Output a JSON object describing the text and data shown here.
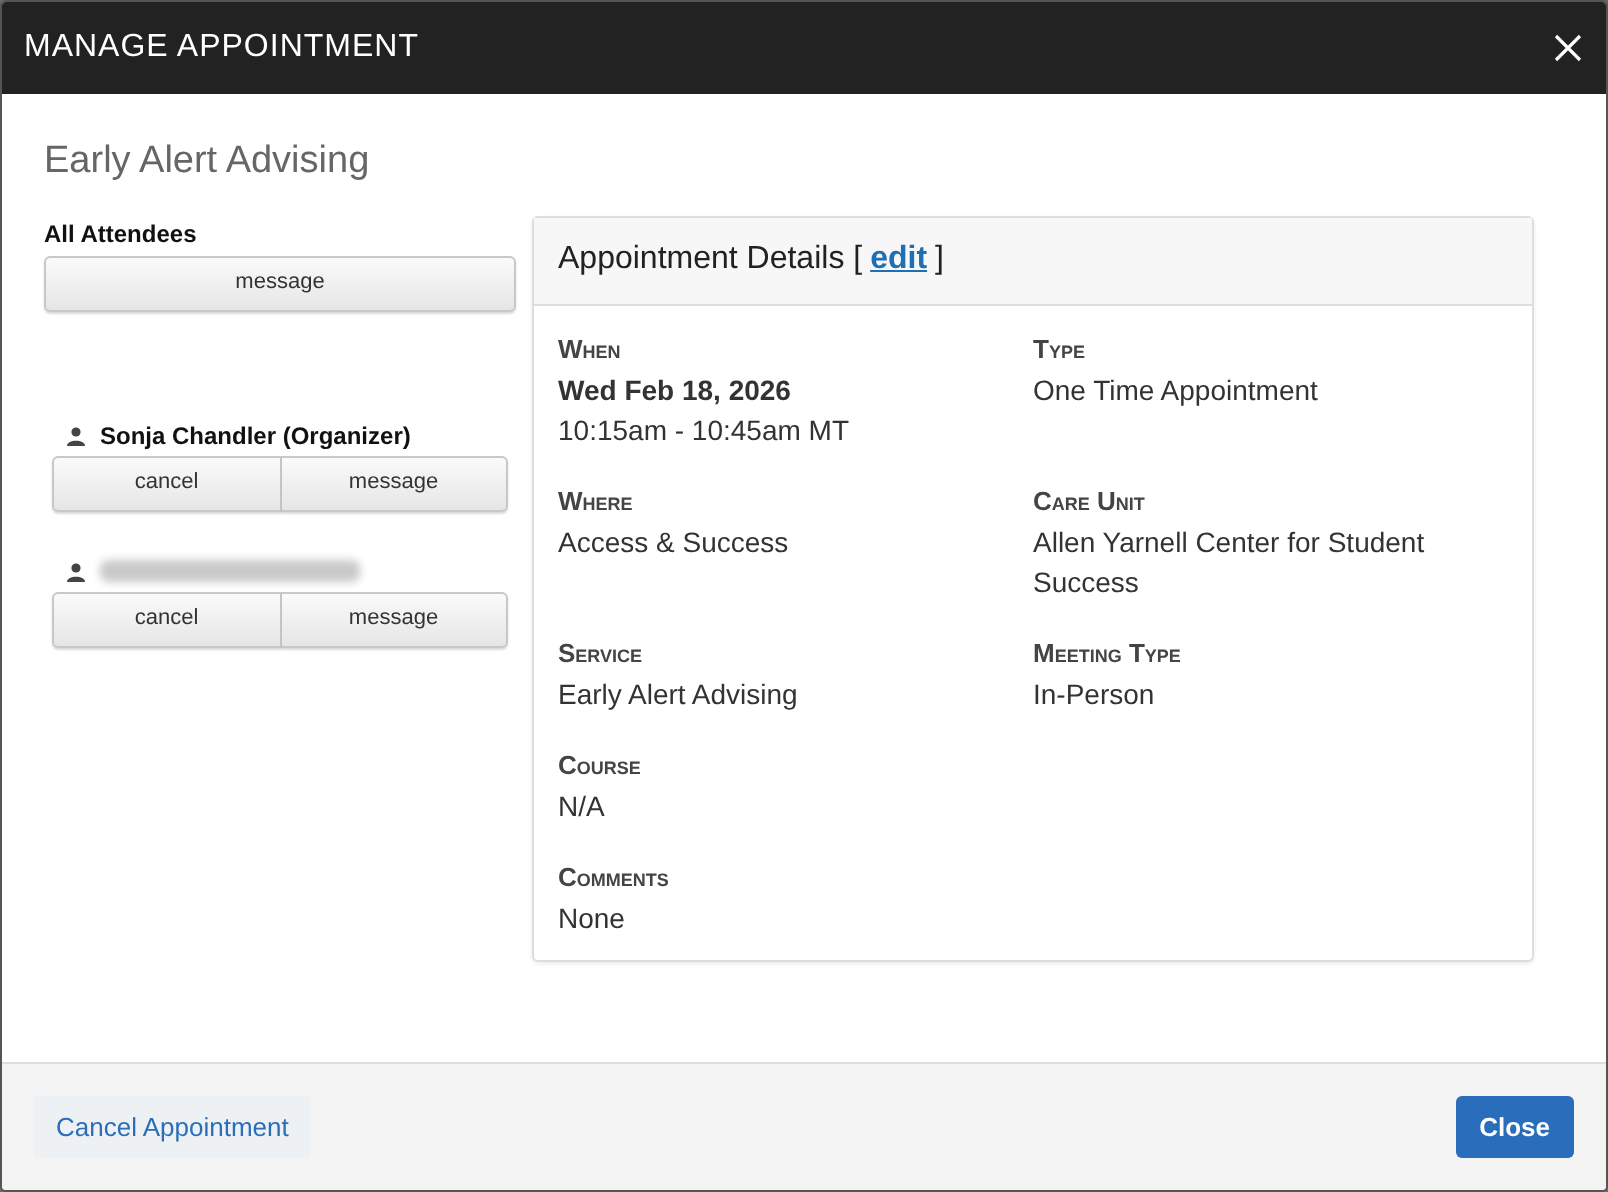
{
  "window": {
    "title": "MANAGE APPOINTMENT"
  },
  "heading": "Early Alert Advising",
  "attendees": {
    "label": "All Attendees",
    "message_button": "message",
    "people": [
      {
        "kind": "named",
        "name": "Sonja Chandler (Organizer)",
        "buttons": [
          "cancel",
          "message"
        ]
      },
      {
        "kind": "redacted",
        "buttons": [
          "cancel",
          "message"
        ]
      }
    ]
  },
  "details": {
    "title": "Appointment Details [",
    "edit_link": "edit",
    "title_end": "]",
    "rows": [
      [
        {
          "label": "When",
          "lines": [
            {
              "text": "Wed Feb 18, 2026",
              "bold": true
            },
            {
              "text": "10:15am - 10:45am MT",
              "bold": false
            }
          ]
        },
        {
          "label": "Type",
          "lines": [
            {
              "text": "One Time Appointment",
              "bold": false
            }
          ]
        }
      ],
      [
        {
          "label": "Where",
          "lines": [
            {
              "text": "Access & Success",
              "bold": false
            }
          ]
        },
        {
          "label": "Care Unit",
          "lines": [
            {
              "text": "Allen Yarnell Center for Student Success",
              "bold": false
            }
          ]
        }
      ],
      [
        {
          "label": "Service",
          "lines": [
            {
              "text": "Early Alert Advising",
              "bold": false
            }
          ]
        },
        {
          "label": "Meeting Type",
          "lines": [
            {
              "text": "In-Person",
              "bold": false
            }
          ]
        }
      ],
      [
        {
          "label": "Course",
          "lines": [
            {
              "text": "N/A",
              "bold": false
            }
          ]
        }
      ],
      [
        {
          "label": "Comments",
          "lines": [
            {
              "text": "None",
              "bold": false
            }
          ]
        }
      ]
    ]
  },
  "footer": {
    "cancel_appointment": "Cancel Appointment",
    "close": "Close"
  }
}
